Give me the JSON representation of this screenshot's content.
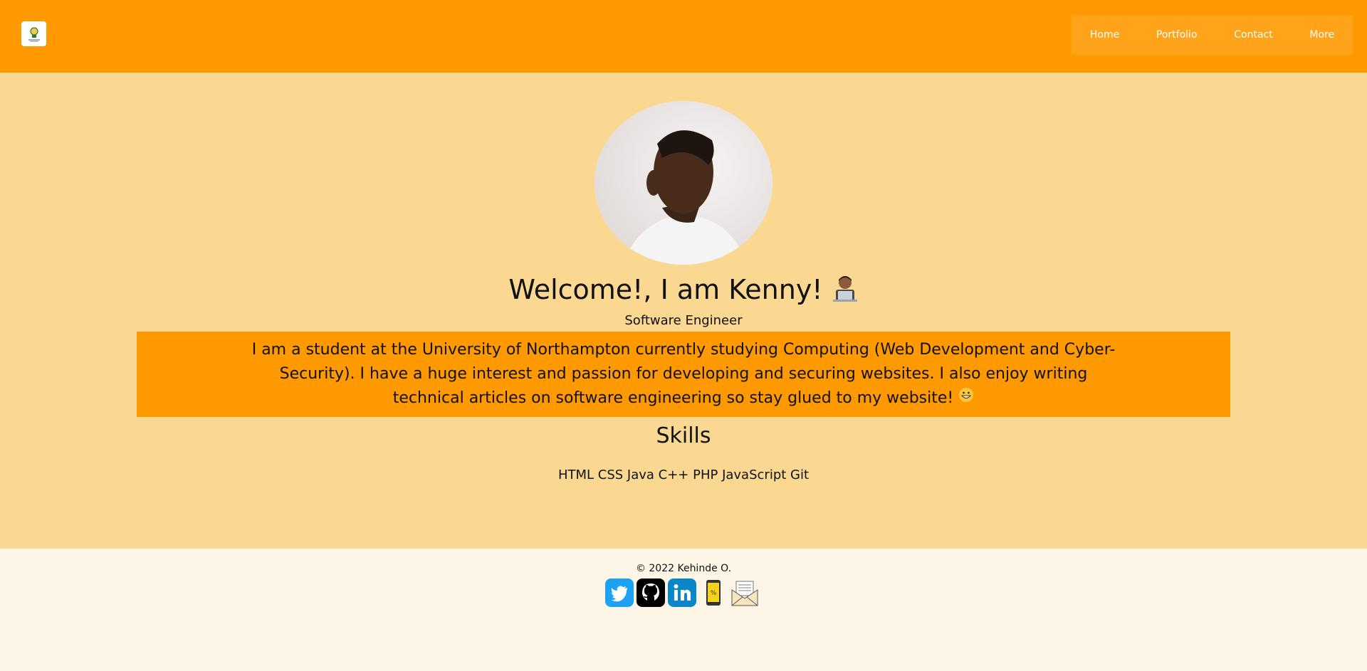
{
  "header": {
    "logo_icon": "bulb-logo-icon",
    "nav": [
      {
        "label": "Home"
      },
      {
        "label": "Portfolio"
      },
      {
        "label": "Contact"
      },
      {
        "label": "More"
      }
    ],
    "colors": {
      "bar": "#ff9900",
      "nav_bg": "#ffa41a"
    }
  },
  "hero": {
    "title": "Welcome!, I am Kenny!",
    "title_emoji": "technologist-emoji",
    "subtitle": "Software Engineer",
    "bio": "I am a student at the University of Northampton currently studying Computing (Web Development and Cyber-Security). I have a huge interest and passion for developing and securing websites. I also enjoy writing technical articles on software engineering so stay glued to my website!",
    "bio_emoji": "grinning-face-emoji",
    "skills_title": "Skills",
    "skills": "HTML CSS Java C++ PHP JavaScript Git",
    "colors": {
      "background": "#fbd891",
      "bio_bg": "#ff9900"
    }
  },
  "footer": {
    "copyright": "© 2022 Kehinde O.",
    "socials": [
      {
        "icon": "twitter-icon"
      },
      {
        "icon": "github-icon"
      },
      {
        "icon": "linkedin-icon"
      },
      {
        "icon": "phone-icon"
      },
      {
        "icon": "envelope-icon"
      }
    ]
  }
}
